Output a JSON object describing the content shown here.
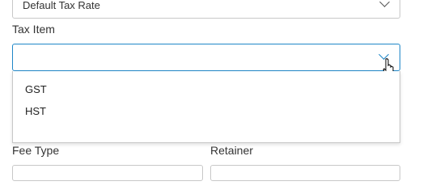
{
  "default_tax": {
    "value": "Default Tax Rate"
  },
  "tax_item": {
    "label": "Tax Item",
    "value": "",
    "options": [
      "GST",
      "HST"
    ]
  },
  "fee_type": {
    "label": "Fee Type"
  },
  "retainer": {
    "label": "Retainer"
  },
  "colors": {
    "focus_border": "#1f87c8",
    "border": "#c8c8c8",
    "text": "#333333"
  }
}
